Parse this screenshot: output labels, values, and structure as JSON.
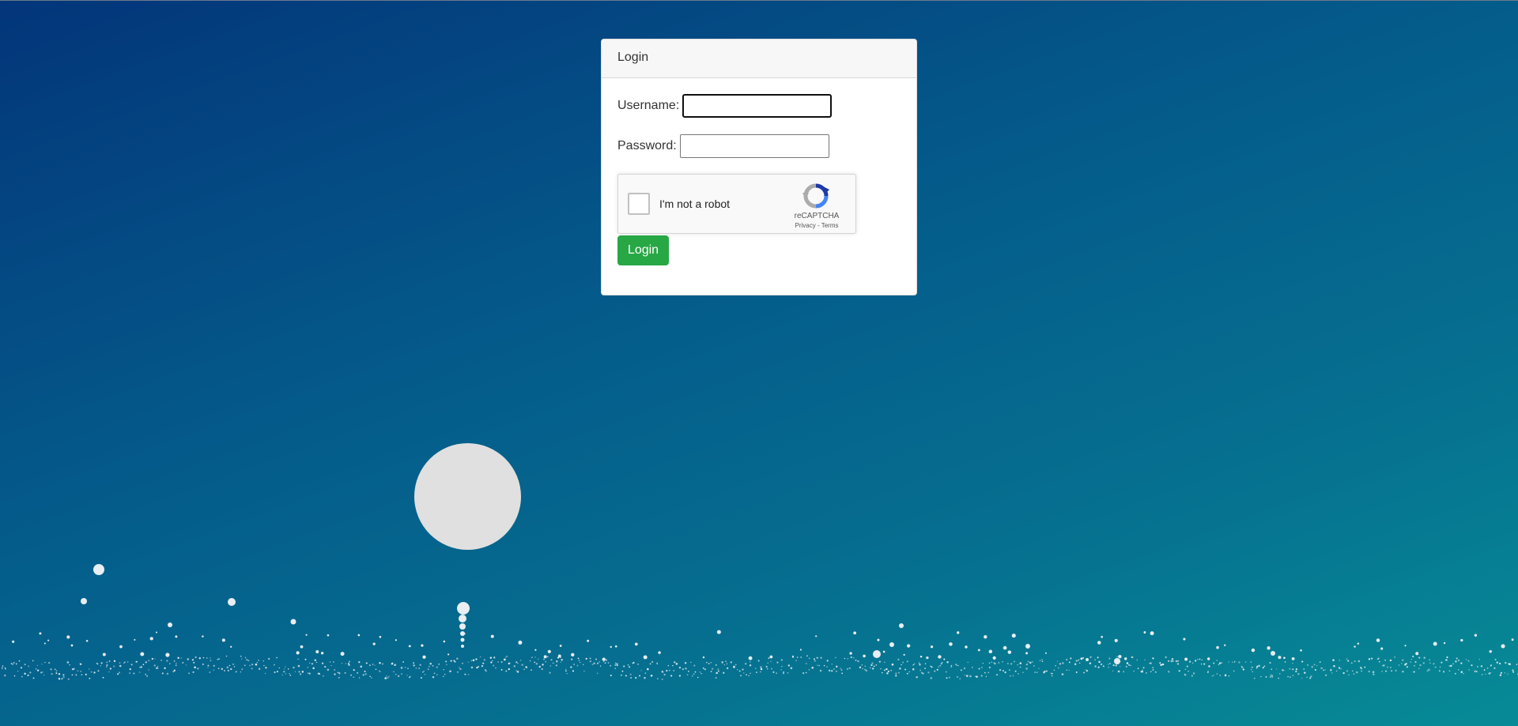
{
  "login_card": {
    "title": "Login",
    "username_label": "Username:",
    "username_value": "",
    "password_label": "Password:",
    "password_value": "",
    "submit_label": "Login"
  },
  "recaptcha": {
    "checkbox_label": "I'm not a robot",
    "brand": "reCAPTCHA",
    "privacy_link": "Privacy",
    "separator": " - ",
    "terms_link": "Terms",
    "checked": false
  },
  "background": {
    "gradient_start": "#03357a",
    "gradient_end": "#078b96",
    "moon_color": "#e0e0e0",
    "particle_color": "#e8eef2"
  },
  "colors": {
    "submit_button": "#28a745"
  }
}
